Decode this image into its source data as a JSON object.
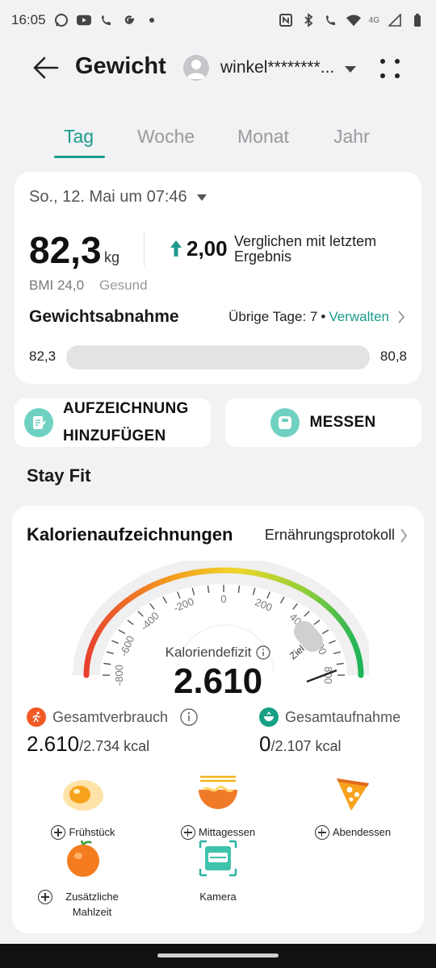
{
  "status_bar": {
    "time": "16:05",
    "network": "4G",
    "left_icons": [
      "whatsapp-icon",
      "youtube-icon",
      "wifi-call-icon",
      "google-icon",
      "dot-icon"
    ],
    "right_icons": [
      "nfc-icon",
      "bluetooth-icon",
      "wifi-call-icon",
      "wifi-icon",
      "signal-icon",
      "battery-icon"
    ]
  },
  "header": {
    "title": "Gewicht",
    "account": "winkel********..."
  },
  "tabs": [
    {
      "label": "Tag",
      "active": true
    },
    {
      "label": "Woche",
      "active": false
    },
    {
      "label": "Monat",
      "active": false
    },
    {
      "label": "Jahr",
      "active": false
    }
  ],
  "weight": {
    "date": "So., 12. Mai um 07:46",
    "value": "82,3",
    "unit": "kg",
    "change_value": "2,00",
    "change_text": "Verglichen mit letztem Ergebnis",
    "bmi": "BMI 24,0",
    "bmi_status": "Gesund",
    "goal_title": "Gewichtsabnahme",
    "days_left": "Übrige Tage: 7",
    "manage_link": "Verwalten",
    "bar_start": "82,3",
    "bar_end": "80,8"
  },
  "actions": {
    "add_record": "AUFZEICHNUNG HINZUFÜGEN",
    "measure": "MESSEN"
  },
  "section": {
    "title": "Stay Fit"
  },
  "calories": {
    "title": "Kalorienaufzeichnungen",
    "link": "Ernährungsprotokoll",
    "gauge_labels": [
      "-800",
      "-600",
      "-400",
      "-200",
      "0",
      "200",
      "400",
      "600",
      "800"
    ],
    "goal_label": "Ziel",
    "deficit_label": "Kaloriendefizit",
    "deficit_value": "2.610",
    "burned_label": "Gesamtverbrauch",
    "burned_value": "2.610",
    "burned_total": "/2.734 kcal",
    "intake_label": "Gesamtaufnahme",
    "intake_value": "0",
    "intake_total": "/2.107 kcal",
    "colors": {
      "accent": "#1c9a8d",
      "burn": "#f15a24",
      "intake": "#17a085"
    }
  },
  "meals": [
    {
      "label": "Frühstück",
      "icon": "breakfast-egg-icon"
    },
    {
      "label": "Mittagessen",
      "icon": "lunch-noodles-icon"
    },
    {
      "label": "Abendessen",
      "icon": "dinner-pizza-icon"
    },
    {
      "label": "Zusätzliche Mahlzeit",
      "icon": "snack-orange-icon"
    },
    {
      "label": "Kamera",
      "icon": "camera-scan-icon"
    }
  ]
}
